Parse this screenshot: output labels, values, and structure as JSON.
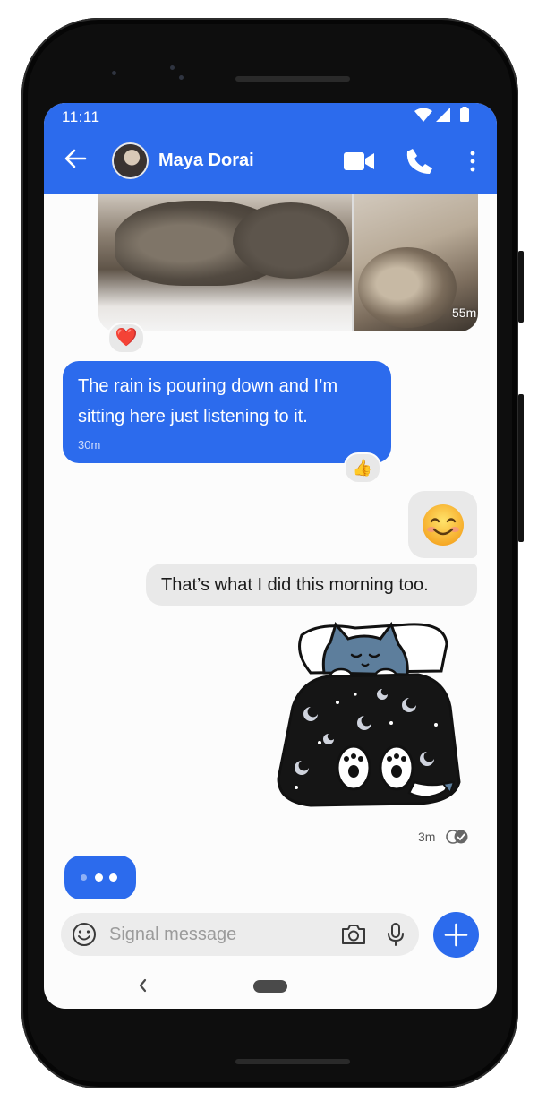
{
  "status_bar": {
    "time": "11:11"
  },
  "header": {
    "title": "Maya Dorai",
    "accent": "#2c6bed",
    "icons": [
      "back-arrow-icon",
      "video-call-icon",
      "voice-call-icon",
      "more-vertical-icon"
    ]
  },
  "messages": {
    "photo_album": {
      "time": "55m",
      "reaction": "❤️"
    },
    "incoming_text": {
      "line1": "The rain is pouring down and I’m",
      "line2": "sitting here just listening to it.",
      "time": "30m",
      "reaction": "👍"
    },
    "outgoing_emoji": "😊",
    "outgoing_text": "That’s what I did this morning too.",
    "sticker": {
      "time": "3m"
    }
  },
  "composer": {
    "placeholder": "Signal message",
    "value": ""
  },
  "colors": {
    "bubble_incoming": "#2c6bed",
    "bubble_outgoing": "#e9e9e9",
    "background": "#fcfcfc"
  }
}
